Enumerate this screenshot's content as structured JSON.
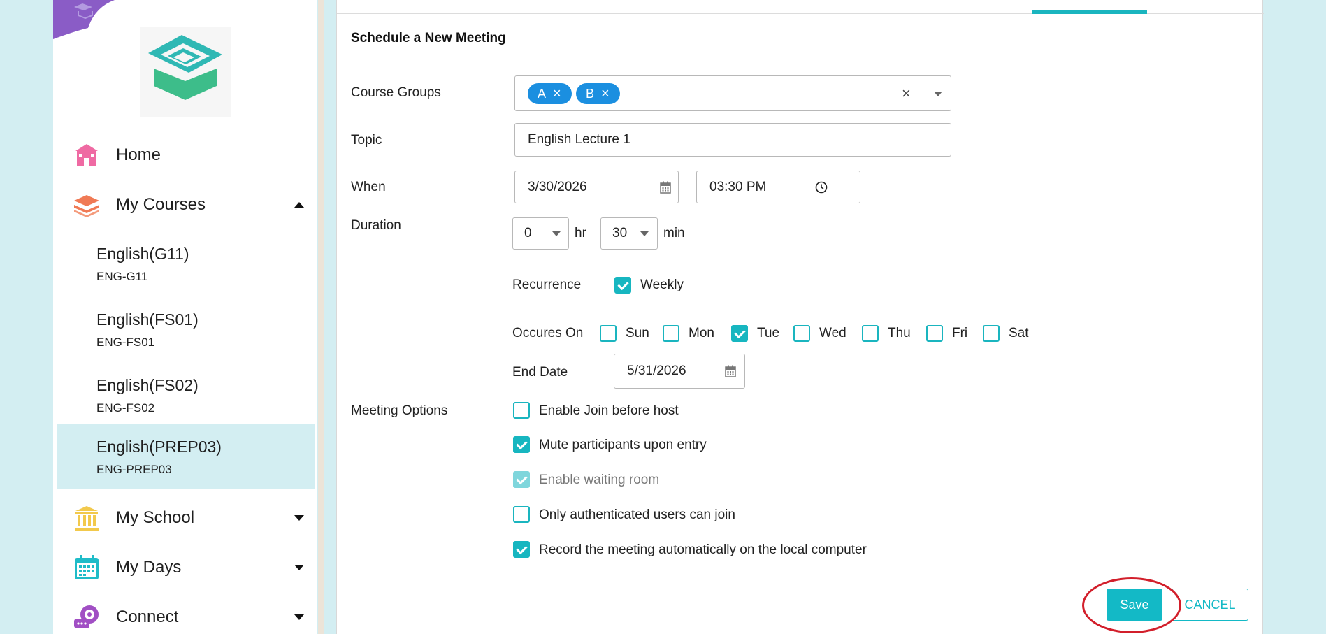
{
  "sidebar": {
    "nav": [
      {
        "label": "Home",
        "icon": "home-icon"
      },
      {
        "label": "My Courses",
        "icon": "courses-icon"
      },
      {
        "label": "My School",
        "icon": "school-icon"
      },
      {
        "label": "My Days",
        "icon": "calendar-icon"
      },
      {
        "label": "Connect",
        "icon": "connect-icon"
      }
    ],
    "courses": [
      {
        "name": "English(G11)",
        "code": "ENG-G11"
      },
      {
        "name": "English(FS01)",
        "code": "ENG-FS01"
      },
      {
        "name": "English(FS02)",
        "code": "ENG-FS02"
      },
      {
        "name": "English(PREP03)",
        "code": "ENG-PREP03"
      }
    ]
  },
  "form": {
    "title": "Schedule a New Meeting",
    "course_groups_label": "Course Groups",
    "chips": [
      "A",
      "B"
    ],
    "chip_remove": "×",
    "clear_all": "×",
    "topic_label": "Topic",
    "topic_value": "English Lecture 1",
    "when_label": "When",
    "date_value": "3/30/2026",
    "time_value": "03:30 PM",
    "duration_label": "Duration",
    "hours_value": "0",
    "hours_unit": "hr",
    "minutes_value": "30",
    "minutes_unit": "min",
    "recurrence_label": "Recurrence",
    "recurrence_value": "Weekly",
    "occurs_label": "Occures On",
    "days": [
      {
        "label": "Sun",
        "checked": false
      },
      {
        "label": "Mon",
        "checked": false
      },
      {
        "label": "Tue",
        "checked": true
      },
      {
        "label": "Wed",
        "checked": false
      },
      {
        "label": "Thu",
        "checked": false
      },
      {
        "label": "Fri",
        "checked": false
      },
      {
        "label": "Sat",
        "checked": false
      }
    ],
    "end_date_label": "End Date",
    "end_date_value": "5/31/2026",
    "meeting_options_label": "Meeting Options",
    "options": [
      {
        "label": "Enable Join before host",
        "state": "unchecked"
      },
      {
        "label": "Mute participants upon entry",
        "state": "checked"
      },
      {
        "label": "Enable waiting room",
        "state": "disabled-checked"
      },
      {
        "label": "Only authenticated users can join",
        "state": "unchecked"
      },
      {
        "label": "Record the meeting automatically on the local computer",
        "state": "checked"
      }
    ],
    "save_label": "Save",
    "cancel_label": "CANCEL"
  },
  "colors": {
    "accent": "#17b6c0",
    "chip": "#1b8fe0",
    "highlight": "#d21f2b",
    "background": "#d3eef2"
  }
}
